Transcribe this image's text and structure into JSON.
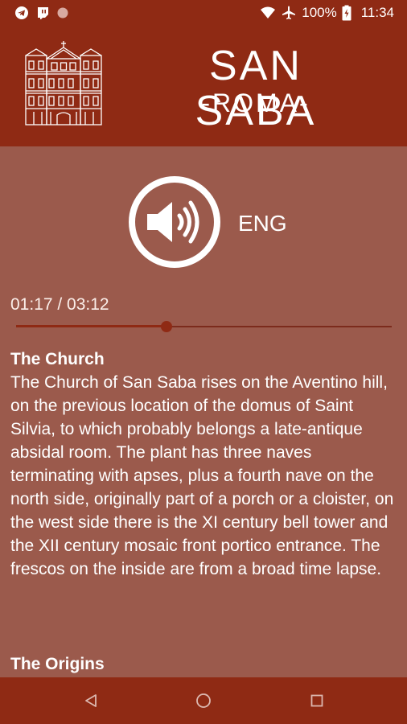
{
  "status_bar": {
    "battery_percent": "100%",
    "time": "11:34",
    "left_icons": [
      "telegram-icon",
      "twitch-icon",
      "dot-icon"
    ],
    "right_icons": [
      "wifi-icon",
      "airplane-icon",
      "battery-icon"
    ]
  },
  "header": {
    "title": "SAN SABA",
    "subtitle": "-ROMA-",
    "logo_icon": "church-facade-logo"
  },
  "player": {
    "speaker_icon": "speaker-icon",
    "language": "ENG",
    "time_readout": "01:17 / 03:12",
    "progress": 0.401,
    "accent_color": "#8f2a14"
  },
  "article": {
    "sections": [
      {
        "title": "The Church",
        "body": "The Church of San Saba rises on the Aventino hill, on the previous location of the domus of Saint Silvia, to which probably belongs a late-antique absidal room. The plant has three naves terminating with apses, plus a fourth nave on the north side, originally part of a porch or a cloister, on the west side there is the XI century bell tower and the XII century mosaic front portico entrance. The frescos on the inside are from a broad time lapse."
      },
      {
        "title": "The Origins"
      }
    ]
  },
  "nav_bar": {
    "icons": [
      "back-icon",
      "home-icon",
      "recents-icon"
    ]
  },
  "colors": {
    "brand": "#8f2a14",
    "background": "#9b5a4c",
    "text": "#ffffff"
  }
}
